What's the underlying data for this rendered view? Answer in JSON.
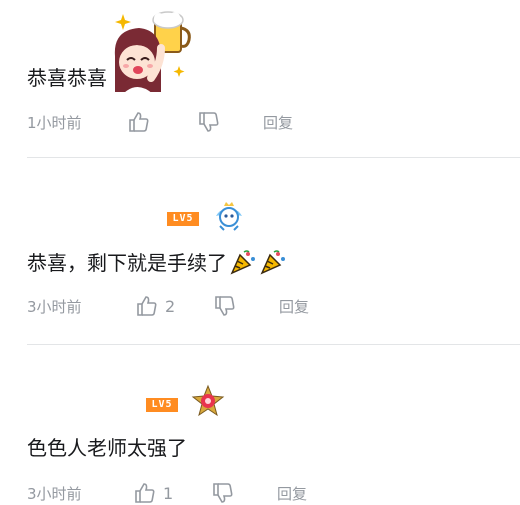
{
  "comments": [
    {
      "text": "恭喜恭喜",
      "time": "1小时前",
      "like_count": "",
      "reply_label": "回复",
      "sticker_icon": "anime-girl-beer-sticker"
    },
    {
      "text": "恭喜，剩下就是手续了",
      "level": "LV5",
      "time": "3小时前",
      "like_count": "2",
      "reply_label": "回复",
      "emoji": [
        "party-popper-emoji",
        "party-popper-emoji"
      ]
    },
    {
      "text": "色色人老师太强了",
      "level": "LV5",
      "time": "3小时前",
      "like_count": "1",
      "reply_label": "回复"
    }
  ],
  "colors": {
    "text": "#18191c",
    "meta": "#9499a0",
    "divider": "#e3e5e7",
    "level_badge": "#ff8c21"
  }
}
